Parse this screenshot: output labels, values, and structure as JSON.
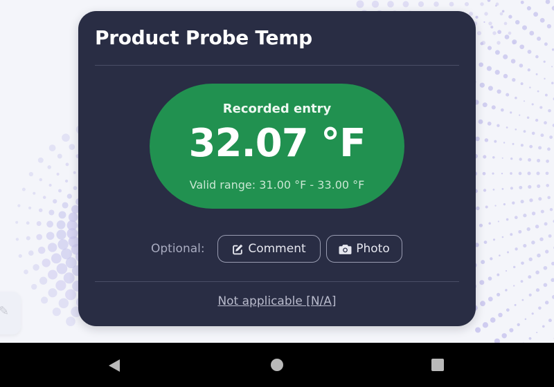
{
  "card": {
    "title": "Product Probe Temp",
    "reading": {
      "label": "Recorded entry",
      "value": "32.07 °F",
      "valid_range": "Valid range: 31.00 °F - 33.00 °F",
      "status_color": "#219150"
    },
    "optional": {
      "label": "Optional:",
      "comment_button": "Comment",
      "photo_button": "Photo"
    },
    "na_link": "Not applicable [N/A]"
  },
  "theme": {
    "card_background": "#292d44",
    "page_background": "#f4f5fa",
    "dot_color": "#c9c6ee"
  },
  "icons": {
    "comment": "edit-icon",
    "photo": "camera-icon",
    "side_tab": "pencil-icon"
  },
  "nav_bar": {
    "back": "back-icon",
    "home": "home-icon",
    "recents": "recents-icon"
  }
}
